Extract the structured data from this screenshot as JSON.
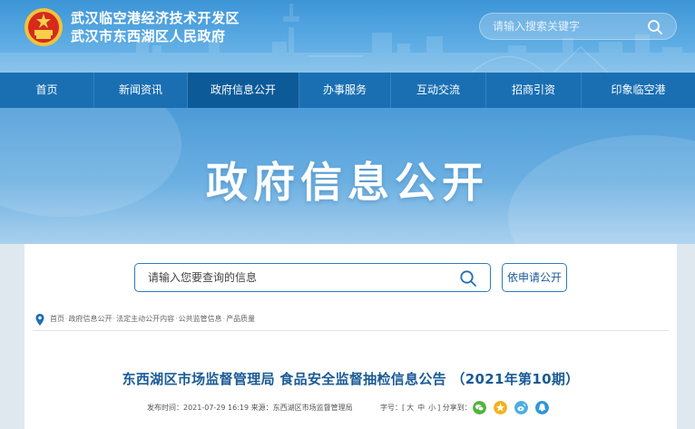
{
  "header": {
    "title_line1": "武汉临空港经济技术开发区",
    "title_line2": "武汉市东西湖区人民政府",
    "search_placeholder": "请输入搜索关键字"
  },
  "nav": {
    "items": [
      {
        "label": "首页"
      },
      {
        "label": "新闻资讯"
      },
      {
        "label": "政府信息公开",
        "active": true
      },
      {
        "label": "办事服务"
      },
      {
        "label": "互动交流"
      },
      {
        "label": "招商引资"
      },
      {
        "label": "印象临空港"
      }
    ]
  },
  "banner": {
    "title": "政府信息公开"
  },
  "info_search": {
    "placeholder": "请输入您要查询的信息",
    "apply_label": "依申请公开"
  },
  "breadcrumb": {
    "items": [
      "首页",
      "政府信息公开",
      "法定主动公开内容",
      "公共监管信息",
      "产品质量"
    ],
    "separator": "·"
  },
  "article": {
    "title": "东西湖区市场监督管理局 食品安全监督抽检信息公告 （2021年第10期）",
    "meta": "发布时间：2021-07-29 16:19 来源：东西湖区市场监督管理局",
    "font_label": "字号：[",
    "font_sizes": [
      "大",
      "中",
      "小"
    ],
    "font_close": "]",
    "share_label": "分享到："
  },
  "colors": {
    "nav_bg": "#1a6fb3",
    "nav_active": "#0d5a99",
    "title_blue": "#1a5a96",
    "share_wechat": "#52b33f",
    "share_star": "#f2b21c",
    "share_weibo": "#4aaee0",
    "share_qq": "#2f95d8"
  },
  "icons": {
    "emblem": "national-emblem-icon",
    "search": "search-icon",
    "pin": "location-pin-icon",
    "share": [
      "wechat-icon",
      "star-icon",
      "weibo-icon",
      "qq-icon"
    ]
  }
}
